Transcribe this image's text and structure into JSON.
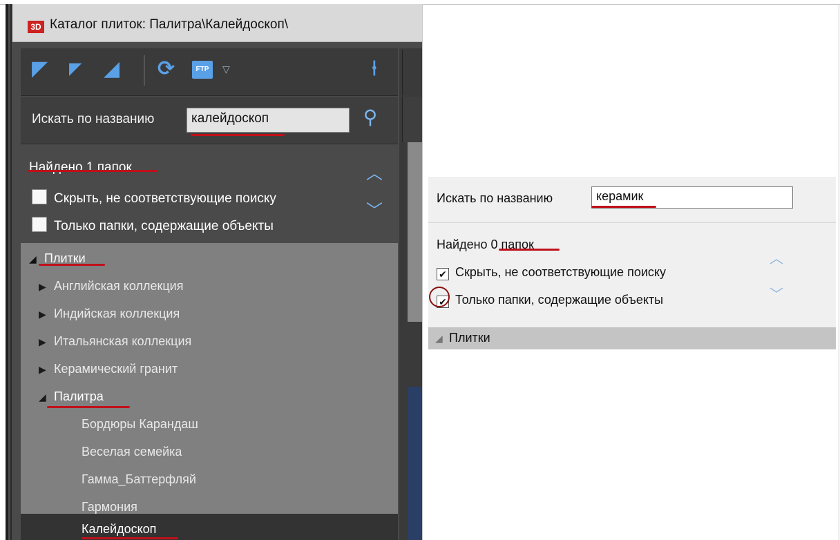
{
  "left": {
    "window_title": "Каталог плиток: Палитра\\Калейдоскоп\\",
    "logo_text": "3D",
    "toolbar": {
      "icons": [
        "expand-all-icon",
        "collapse-icon",
        "expand-icon",
        "refresh-icon",
        "ftp-icon",
        "dropdown-arrow-icon",
        "pin-icon"
      ],
      "ftp_label": "FTP"
    },
    "search": {
      "label": "Искать по названию",
      "value": "калейдоскоп"
    },
    "found_text": "Найдено 1 папок",
    "checkbox_hide": "Скрыть, не соответствующие поиску",
    "checkbox_only": "Только папки, содержащие объекты",
    "tree": {
      "root": "Плитки",
      "children": [
        "Английская коллекция",
        "Индийская коллекция",
        "Итальянская коллекция",
        "Керамический гранит"
      ],
      "open_folder": "Палитра",
      "grandchildren": [
        "Бордюры Карандаш",
        "Веселая семейка",
        "Гамма_Баттерфляй",
        "Гармония"
      ],
      "selected": "Калейдоскоп"
    }
  },
  "right": {
    "search": {
      "label": "Искать по названию",
      "value": "керамик"
    },
    "found_prefix": "Найдено ",
    "found_highlight": "0 папок",
    "checkbox_hide": "Скрыть, не соответствующие поиску",
    "checkbox_only": "Только папки, содержащие объекты",
    "checkbox_hide_checked": true,
    "checkbox_only_checked": true,
    "tree_root": "Плитки"
  },
  "colors": {
    "accent_blue": "#5aa0e6",
    "underline_red": "#c0101a",
    "circle_dark_red": "#8b1010"
  }
}
